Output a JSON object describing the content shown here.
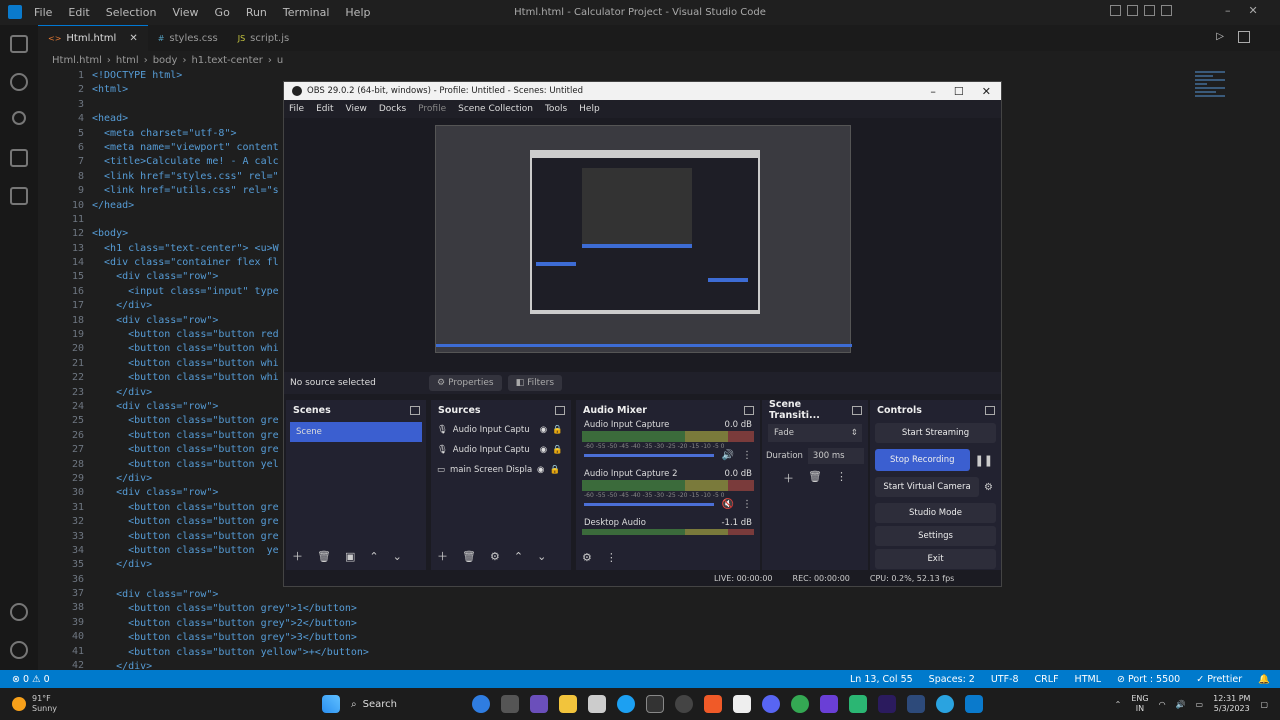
{
  "vscode": {
    "menu": [
      "File",
      "Edit",
      "Selection",
      "View",
      "Go",
      "Run",
      "Terminal",
      "Help"
    ],
    "window_title": "Html.html - Calculator Project - Visual Studio Code",
    "tabs": [
      {
        "label": "Html.html",
        "ext": "<>",
        "active": true
      },
      {
        "label": "styles.css",
        "ext": "#",
        "active": false
      },
      {
        "label": "script.js",
        "ext": "JS",
        "active": false
      }
    ],
    "breadcrumb": [
      "Html.html",
      "html",
      "body",
      "h1.text-center",
      "u"
    ],
    "line_numbers": [
      "1",
      "2",
      "3",
      "4",
      "5",
      "6",
      "7",
      "8",
      "9",
      "10",
      "11",
      "12",
      "13",
      "14",
      "15",
      "16",
      "17",
      "18",
      "19",
      "20",
      "21",
      "22",
      "23",
      "24",
      "25",
      "26",
      "27",
      "28",
      "29",
      "30",
      "31",
      "32",
      "33",
      "34",
      "35",
      "36",
      "37",
      "38",
      "39",
      "40",
      "41",
      "42"
    ],
    "code_lines": [
      "<!DOCTYPE html>",
      "<html>",
      "",
      "<head>",
      "  <meta charset=\"utf-8\">",
      "  <meta name=\"viewport\" content",
      "  <title>Calculate me! - A calc",
      "  <link href=\"styles.css\" rel=\"",
      "  <link href=\"utils.css\" rel=\"s",
      "</head>",
      "",
      "<body>",
      "  <h1 class=\"text-center\"> <u>W",
      "  <div class=\"container flex fl",
      "    <div class=\"row\">",
      "      <input class=\"input\" type",
      "    </div>",
      "    <div class=\"row\">",
      "      <button class=\"button red",
      "      <button class=\"button whi",
      "      <button class=\"button whi",
      "      <button class=\"button whi",
      "    </div>",
      "    <div class=\"row\">",
      "      <button class=\"button gre",
      "      <button class=\"button gre",
      "      <button class=\"button gre",
      "      <button class=\"button yel",
      "    </div>",
      "    <div class=\"row\">",
      "      <button class=\"button gre",
      "      <button class=\"button gre",
      "      <button class=\"button gre",
      "      <button class=\"button  ye",
      "    </div>"
    ],
    "code_lines_low": [
      "    <div class=\"row\">",
      "      <button class=\"button grey\">1</button>",
      "      <button class=\"button grey\">2</button>",
      "      <button class=\"button grey\">3</button>",
      "      <button class=\"button yellow\">+</button>",
      "    </div>",
      "    <div class=\"row\">"
    ],
    "status": {
      "errors": "⊗ 0 ⚠ 0",
      "position": "Ln 13, Col 55",
      "spaces": "Spaces: 2",
      "encoding": "UTF-8",
      "eol": "CRLF",
      "language": "HTML",
      "port": "⊘ Port : 5500",
      "prettier": "✓ Prettier"
    }
  },
  "obs": {
    "title": "OBS 29.0.2 (64-bit, windows) - Profile: Untitled - Scenes: Untitled",
    "menu": [
      "File",
      "Edit",
      "View",
      "Docks",
      "Profile",
      "Scene Collection",
      "Tools",
      "Help"
    ],
    "no_source": "No source selected",
    "properties": "Properties",
    "filters": "Filters",
    "scenes": {
      "title": "Scenes",
      "items": [
        "Scene"
      ]
    },
    "sources": {
      "title": "Sources",
      "items": [
        "Audio Input Captu",
        "Audio Input Captu",
        "main Screen Displa"
      ]
    },
    "mixer": {
      "title": "Audio Mixer",
      "channels": [
        {
          "name": "Audio Input Capture",
          "db": "0.0 dB"
        },
        {
          "name": "Audio Input Capture 2",
          "db": "0.0 dB"
        },
        {
          "name": "Desktop Audio",
          "db": "-1.1 dB"
        }
      ],
      "scale": "-60 -55 -50 -45 -40 -35 -30 -25 -20 -15 -10 -5 0"
    },
    "transitions": {
      "title": "Scene Transiti...",
      "type": "Fade",
      "duration_label": "Duration",
      "duration": "300 ms"
    },
    "controls": {
      "title": "Controls",
      "start_streaming": "Start Streaming",
      "stop_recording": "Stop Recording",
      "start_virtual_camera": "Start Virtual Camera",
      "studio_mode": "Studio Mode",
      "settings": "Settings",
      "exit": "Exit"
    },
    "stats": {
      "live": "LIVE: 00:00:00",
      "rec": "REC: 00:00:00",
      "cpu": "CPU: 0.2%, 52.13 fps"
    }
  },
  "taskbar": {
    "weather_temp": "91°F",
    "weather_desc": "Sunny",
    "search": "Search",
    "lang": "ENG",
    "region": "IN",
    "time": "12:31 PM",
    "date": "5/3/2023"
  },
  "colors": {
    "accent": "#007acc",
    "obs_blue": "#3b5fd0"
  }
}
